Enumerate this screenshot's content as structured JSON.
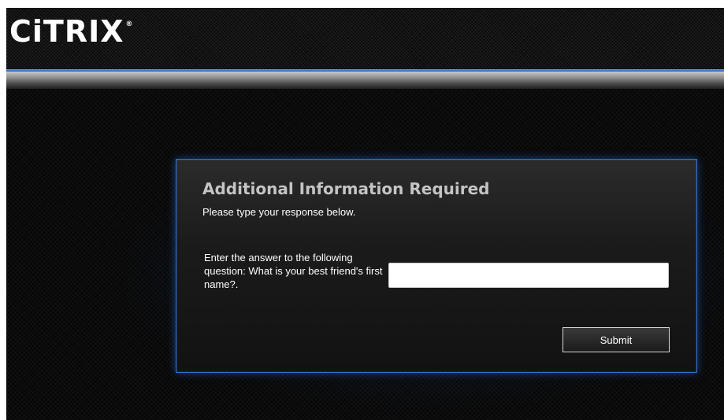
{
  "header": {
    "logo_text": "CiTRIX",
    "logo_registered_mark": "®"
  },
  "panel": {
    "title": "Additional Information Required",
    "subtitle": "Please type your response below.",
    "question_label": "Enter the answer to the following question: What is your best friend's first name?.",
    "answer_value": "",
    "answer_placeholder": "",
    "submit_label": "Submit"
  },
  "colors": {
    "accent_blue": "#2f6fd6",
    "background": "#070707",
    "title_gray": "#c4c4c4"
  }
}
